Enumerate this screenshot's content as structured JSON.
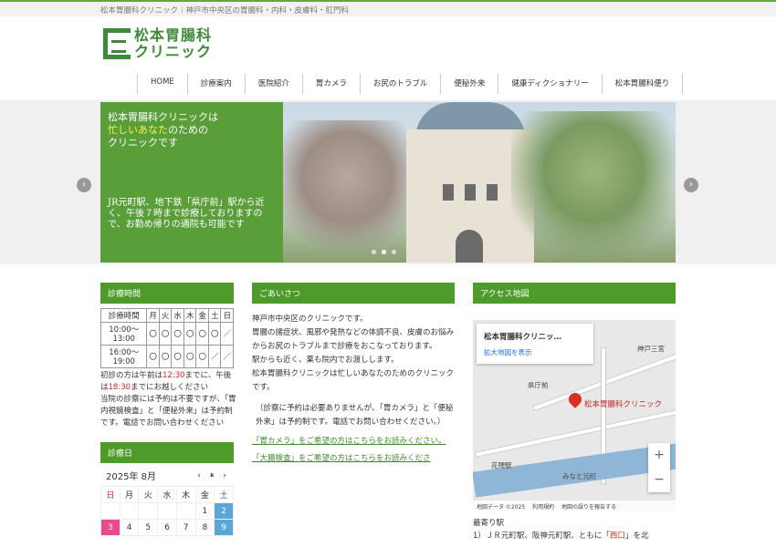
{
  "top_bar": {
    "text": "松本胃腸科クリニック｜神戸市中央区の胃腸科・内科・皮膚科・肛門科"
  },
  "logo": {
    "line1": "松本胃腸科",
    "line2": "クリニック"
  },
  "nav": {
    "items": [
      "HOME",
      "診療案内",
      "医院紹介",
      "胃カメラ",
      "お尻のトラブル",
      "便秘外来",
      "健康ディクショナリー",
      "松本胃腸科便り"
    ]
  },
  "hero": {
    "line1": "松本胃腸科クリニックは",
    "line2_highlight": "忙しいあなた",
    "line2_rest": "のための",
    "line3": "クリニックです",
    "sub": "JR元町駅、地下鉄「県庁前」駅から近く、午後７時まで診療しておりますので、お勤め帰りの通院も可能です",
    "prev": "‹",
    "next": "›"
  },
  "hours": {
    "title": "診療時間",
    "header": [
      "診療時間",
      "月",
      "火",
      "水",
      "木",
      "金",
      "土",
      "日"
    ],
    "rows": [
      [
        "10:00～13:00",
        "〇",
        "〇",
        "〇",
        "〇",
        "〇",
        "〇",
        "／"
      ],
      [
        "16:00～19:00",
        "〇",
        "〇",
        "〇",
        "〇",
        "〇",
        "／",
        "／"
      ]
    ],
    "note1_a": "初診の方は午前は",
    "note1_time1": "12:30",
    "note1_b": "までに、午後は",
    "note1_time2": "18:30",
    "note1_c": "までにお越しください",
    "note2": "当院の診察には予約は不要ですが、「胃内視鏡検査」と「便秘外来」は予約制です。電話でお問い合わせください"
  },
  "calendar": {
    "title": "診療日",
    "month": "2025年 8月",
    "prev": "‹",
    "pause": "⏸",
    "next": "›",
    "weekdays": [
      "日",
      "月",
      "火",
      "水",
      "木",
      "金",
      "土"
    ],
    "row1": [
      "",
      "",
      "",
      "",
      "",
      "1",
      "2"
    ],
    "row2": [
      "3",
      "4",
      "5",
      "6",
      "7",
      "8",
      "9"
    ]
  },
  "greeting": {
    "title": "ごあいさつ",
    "p1": "神戸市中央区のクリニックです。",
    "p2": "胃腸の諸症状、風邪や発熱などの体調不良、皮膚のお悩みからお尻のトラブルまで診療をおこなっております。",
    "p3": "駅からも近く、薬も院内でお渡しします。",
    "p4": "松本胃腸科クリニックは忙しいあなたのためのクリニックです。",
    "p5": "（診察に予約は必要ありませんが、「胃カメラ」と「便秘外来」は予約制です。電話でお問い合わせください。）",
    "link1": "「胃カメラ」をご希望の方はこちらをお読みください。",
    "link2": "「大腸検査」をご希望の方はこちらをお読みくださ"
  },
  "access": {
    "title": "アクセス地図",
    "card_title": "松本胃腸科クリニッ…",
    "card_link": "拡大地図を表示",
    "pin_label": "松本胃腸科クリニック",
    "labels": {
      "kenchomae": "県庁前",
      "hanakuma": "花隈駅",
      "motomachi_sanchome": "みなと元町",
      "kobe": "神戸三宮"
    },
    "zoom_in": "+",
    "zoom_out": "−",
    "footer": "地図データ ©2025 　利用規約　 地図の誤りを報告する",
    "nearest_title": "最寄り駅",
    "nearest_text_a": "1）ＪＲ元町駅、阪神元町駅、ともに「",
    "nearest_text_west": "西口",
    "nearest_text_b": "」を北"
  }
}
